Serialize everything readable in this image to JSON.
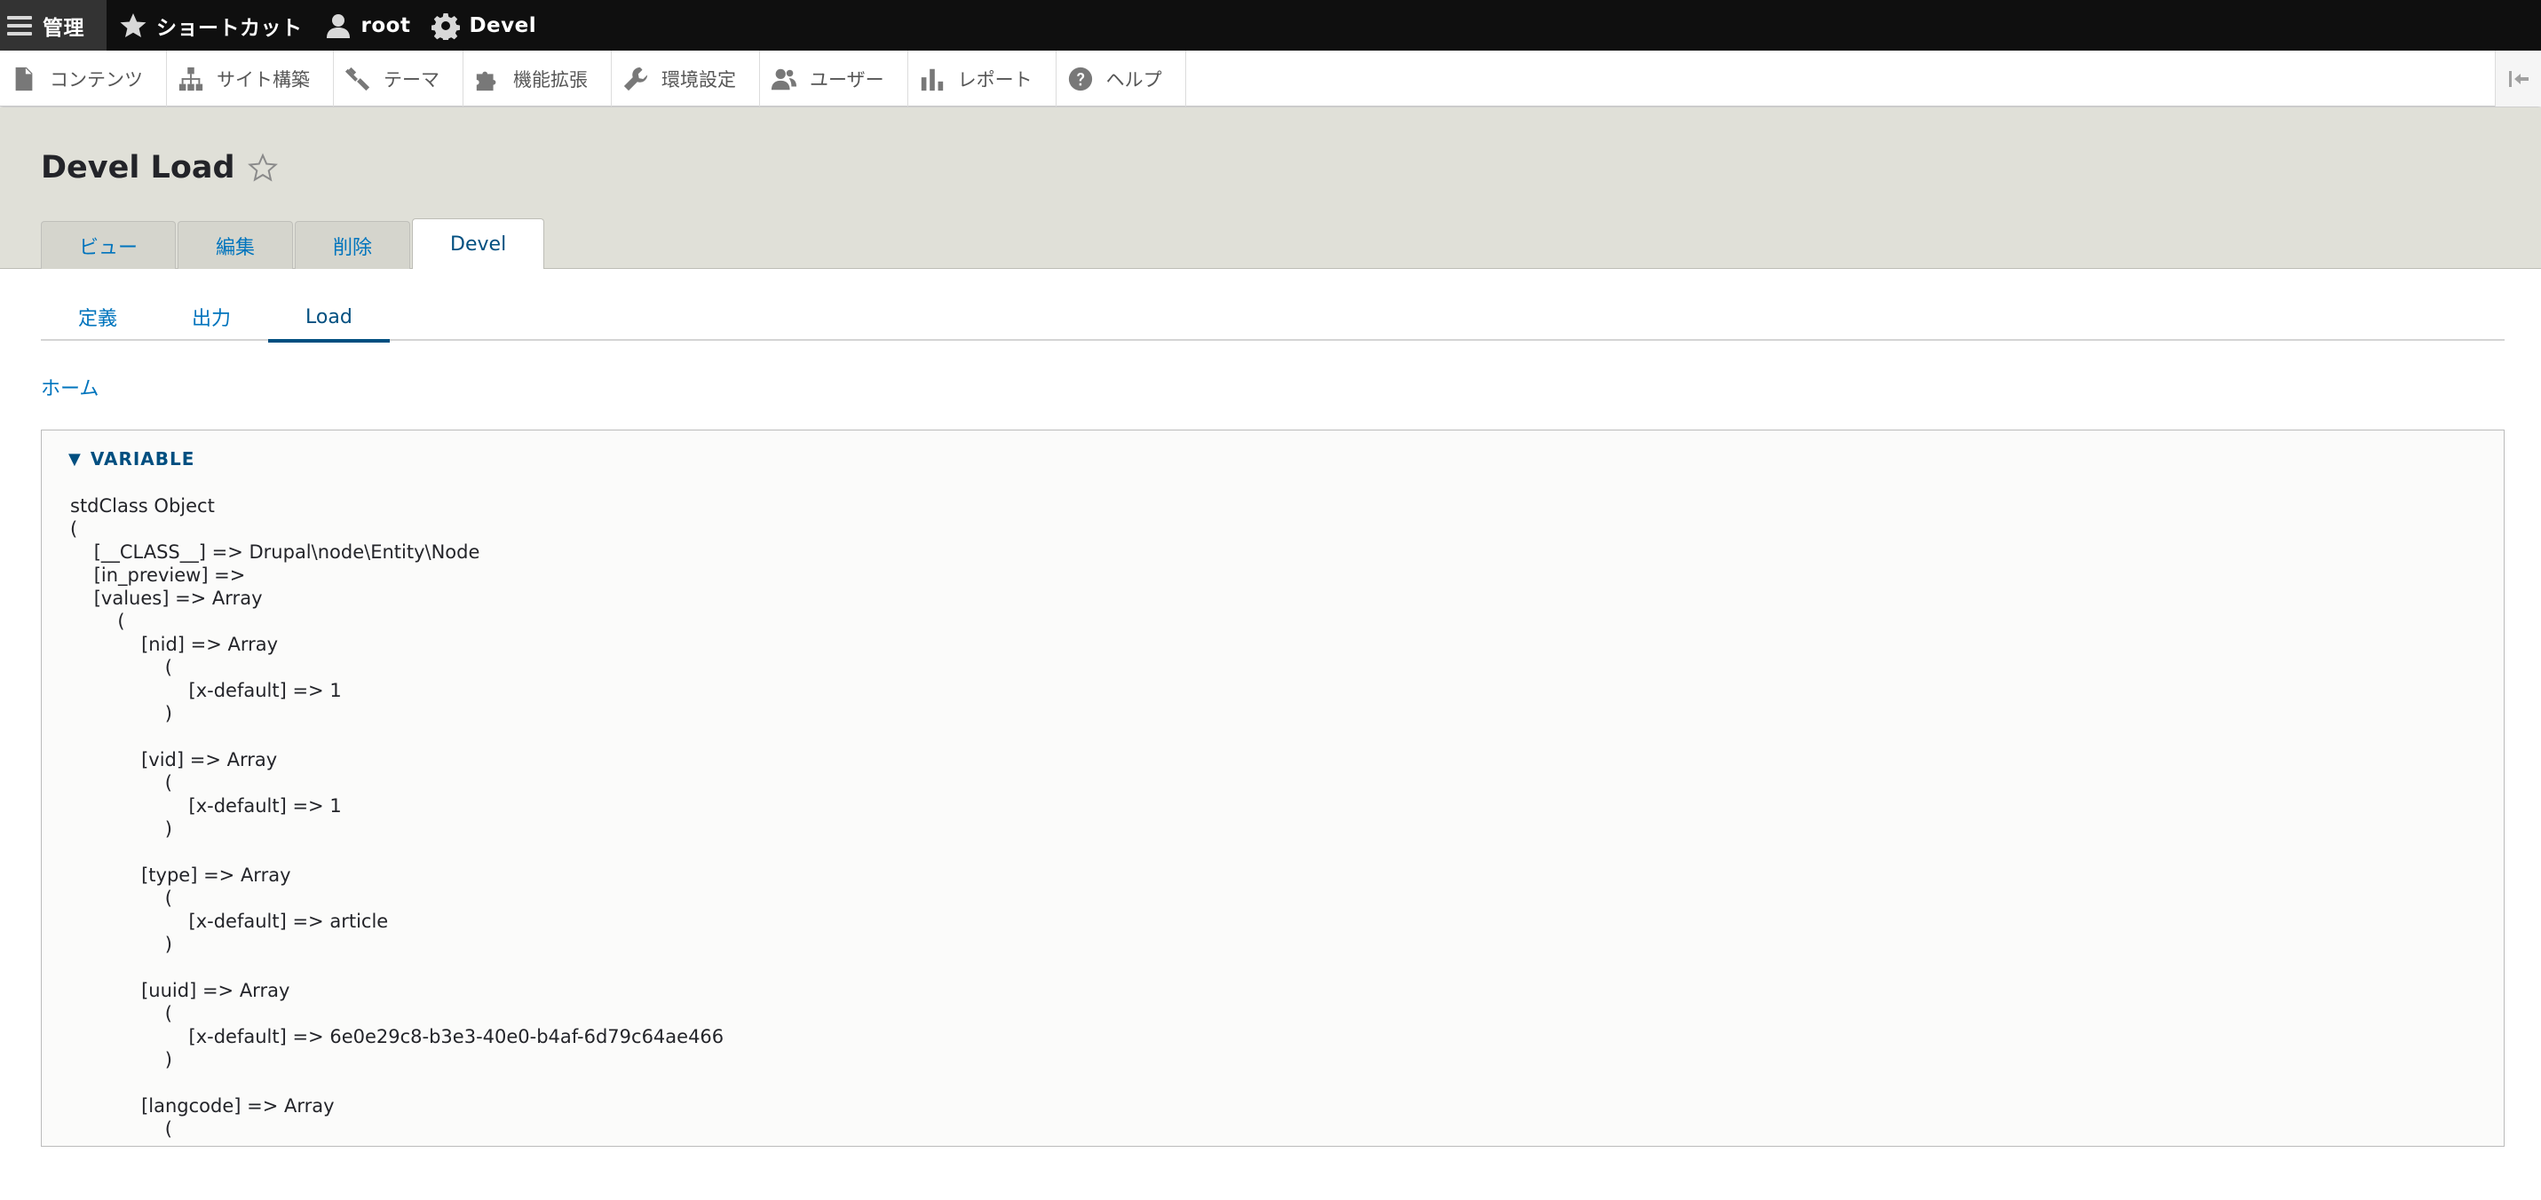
{
  "toolbar": {
    "manage_label": "管理",
    "shortcuts_label": "ショートカット",
    "user_label": "root",
    "devel_label": "Devel"
  },
  "tray": {
    "items": [
      {
        "label": "コンテンツ",
        "icon": "file-icon"
      },
      {
        "label": "サイト構築",
        "icon": "sitemap-icon"
      },
      {
        "label": "テーマ",
        "icon": "paint-icon"
      },
      {
        "label": "機能拡張",
        "icon": "puzzle-icon"
      },
      {
        "label": "環境設定",
        "icon": "wrench-icon"
      },
      {
        "label": "ユーザー",
        "icon": "people-icon"
      },
      {
        "label": "レポート",
        "icon": "bar-chart-icon"
      },
      {
        "label": "ヘルプ",
        "icon": "question-icon"
      }
    ]
  },
  "page": {
    "title": "Devel Load"
  },
  "primary_tabs": [
    {
      "label": "ビュー",
      "active": false
    },
    {
      "label": "編集",
      "active": false
    },
    {
      "label": "削除",
      "active": false
    },
    {
      "label": "Devel",
      "active": true
    }
  ],
  "secondary_tabs": [
    {
      "label": "定義",
      "active": false
    },
    {
      "label": "出力",
      "active": false
    },
    {
      "label": "Load",
      "active": true
    }
  ],
  "breadcrumb": {
    "home": "ホーム"
  },
  "variable": {
    "summary": "VARIABLE",
    "lines": [
      "stdClass Object",
      "(",
      "    [__CLASS__] => Drupal\\node\\Entity\\Node",
      "    [in_preview] =>",
      "    [values] => Array",
      "        (",
      "            [nid] => Array",
      "                (",
      "                    [x-default] => 1",
      "                )",
      "",
      "            [vid] => Array",
      "                (",
      "                    [x-default] => 1",
      "                )",
      "",
      "            [type] => Array",
      "                (",
      "                    [x-default] => article",
      "                )",
      "",
      "            [uuid] => Array",
      "                (",
      "                    [x-default] => 6e0e29c8-b3e3-40e0-b4af-6d79c64ae466",
      "                )",
      "",
      "            [langcode] => Array",
      "                ("
    ]
  },
  "colors": {
    "link": "#0074bd",
    "active_link": "#004f80",
    "toolbar_bg": "#0f0f0f",
    "header_bg": "#e0e0d8"
  }
}
